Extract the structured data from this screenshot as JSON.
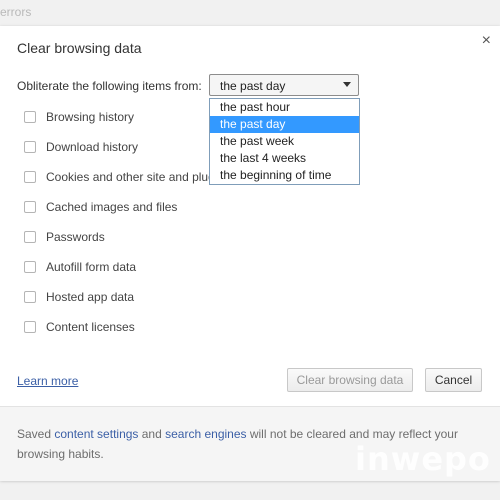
{
  "background": {
    "text": "errors"
  },
  "dialog": {
    "title": "Clear browsing data",
    "close_glyph": "×",
    "obliterate_label": "Obliterate the following items from:",
    "time_range": {
      "selected": "the past day",
      "options": [
        "the past hour",
        "the past day",
        "the past week",
        "the last 4 weeks",
        "the beginning of time"
      ]
    },
    "items": [
      {
        "label": "Browsing history",
        "checked": false
      },
      {
        "label": "Download history",
        "checked": false
      },
      {
        "label": "Cookies and other site and plug",
        "checked": false
      },
      {
        "label": "Cached images and files",
        "checked": false
      },
      {
        "label": "Passwords",
        "checked": false
      },
      {
        "label": "Autofill form data",
        "checked": false
      },
      {
        "label": "Hosted app data",
        "checked": false
      },
      {
        "label": "Content licenses",
        "checked": false
      }
    ],
    "learn_more": "Learn more",
    "clear_button": "Clear browsing data",
    "cancel_button": "Cancel",
    "footer": {
      "prefix": "Saved ",
      "link1": "content settings",
      "middle": " and ",
      "link2": "search engines",
      "suffix": " will not be cleared and may reflect your browsing habits."
    }
  },
  "watermark": "inwepo",
  "colors": {
    "link": "#3b5fa6",
    "selected_option": "#3399ff"
  }
}
